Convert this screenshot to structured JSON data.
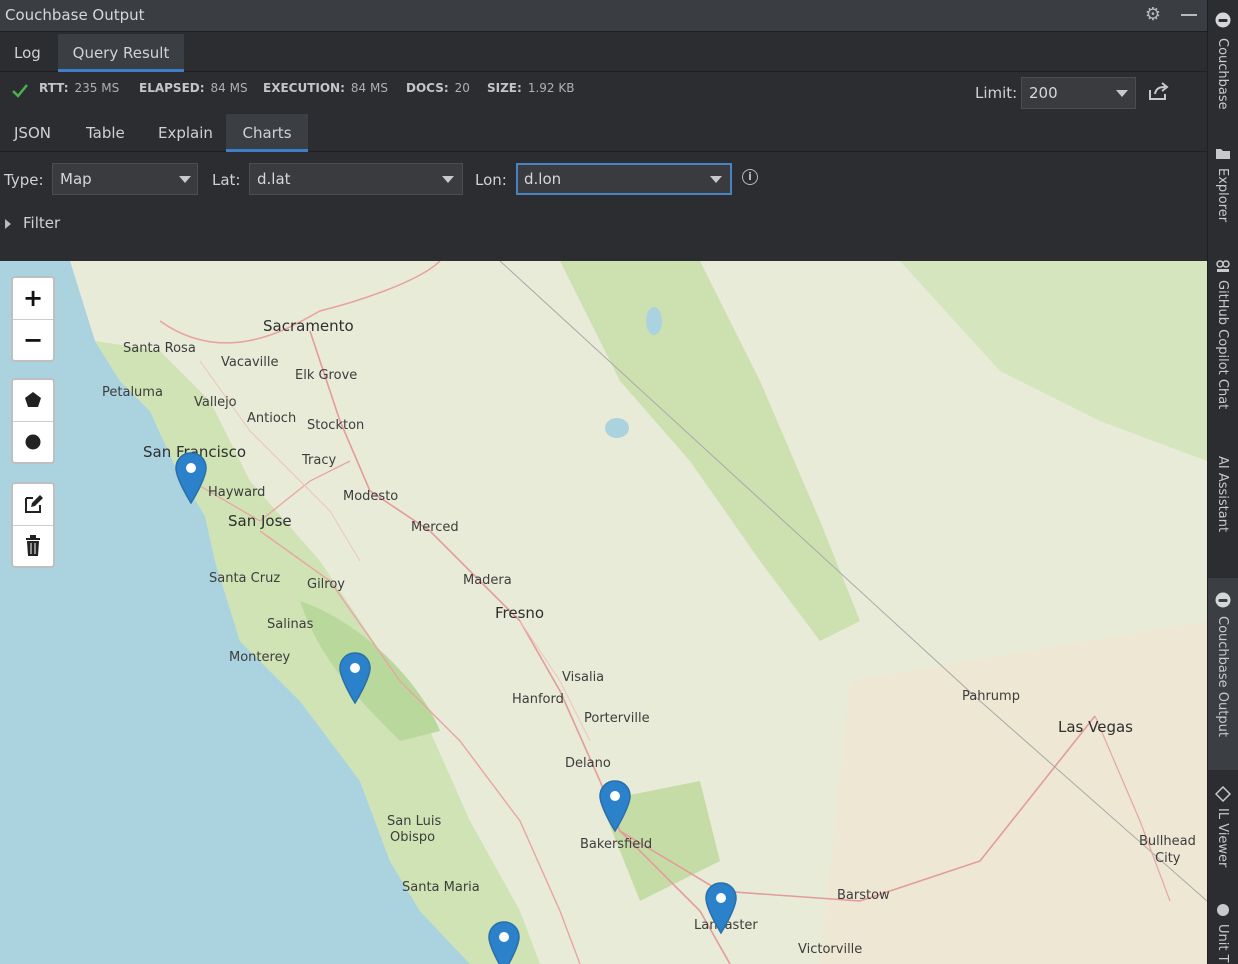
{
  "window": {
    "title": "Couchbase Output"
  },
  "top_tabs": [
    {
      "label": "Log"
    },
    {
      "label": "Query Result"
    }
  ],
  "stats": {
    "rtt_key": "RTT:",
    "rtt_val": "235 MS",
    "elapsed_key": "ELAPSED:",
    "elapsed_val": "84 MS",
    "execution_key": "EXECUTION:",
    "execution_val": "84 MS",
    "docs_key": "DOCS:",
    "docs_val": "20",
    "size_key": "SIZE:",
    "size_val": "1.92 KB"
  },
  "limit": {
    "label": "Limit:",
    "value": "200"
  },
  "result_tabs": [
    {
      "label": "JSON"
    },
    {
      "label": "Table"
    },
    {
      "label": "Explain"
    },
    {
      "label": "Charts"
    }
  ],
  "chart_controls": {
    "type_label": "Type:",
    "type_value": "Map",
    "lat_label": "Lat:",
    "lat_value": "d.lat",
    "lon_label": "Lon:",
    "lon_value": "d.lon"
  },
  "filter": {
    "label": "Filter"
  },
  "map": {
    "cities": {
      "sacramento": "Sacramento",
      "santa_rosa": "Santa Rosa",
      "vacaville": "Vacaville",
      "elk_grove": "Elk Grove",
      "petaluma": "Petaluma",
      "vallejo": "Vallejo",
      "antioch": "Antioch",
      "stockton": "Stockton",
      "san_francisco": "San Francisco",
      "tracy": "Tracy",
      "hayward": "Hayward",
      "modesto": "Modesto",
      "san_jose": "San Jose",
      "merced": "Merced",
      "santa_cruz": "Santa Cruz",
      "gilroy": "Gilroy",
      "madera": "Madera",
      "fresno": "Fresno",
      "salinas": "Salinas",
      "monterey": "Monterey",
      "visalia": "Visalia",
      "hanford": "Hanford",
      "porterville": "Porterville",
      "delano": "Delano",
      "pahrump": "Pahrump",
      "las_vegas": "Las Vegas",
      "san_luis": "San Luis",
      "obispo": "Obispo",
      "bakersfield": "Bakersfield",
      "bullhead": "Bullhead",
      "city": "City",
      "santa_maria": "Santa Maria",
      "barstow": "Barstow",
      "lancaster": "Lancaster",
      "victorville": "Victorville"
    },
    "zoom_in": "+",
    "zoom_out": "−"
  },
  "sidebar": [
    {
      "label": "Couchbase"
    },
    {
      "label": "Explorer"
    },
    {
      "label": "GitHub Copilot Chat"
    },
    {
      "label": "AI Assistant"
    },
    {
      "label": "Couchbase Output"
    },
    {
      "label": "IL Viewer"
    },
    {
      "label": "Unit T"
    }
  ]
}
